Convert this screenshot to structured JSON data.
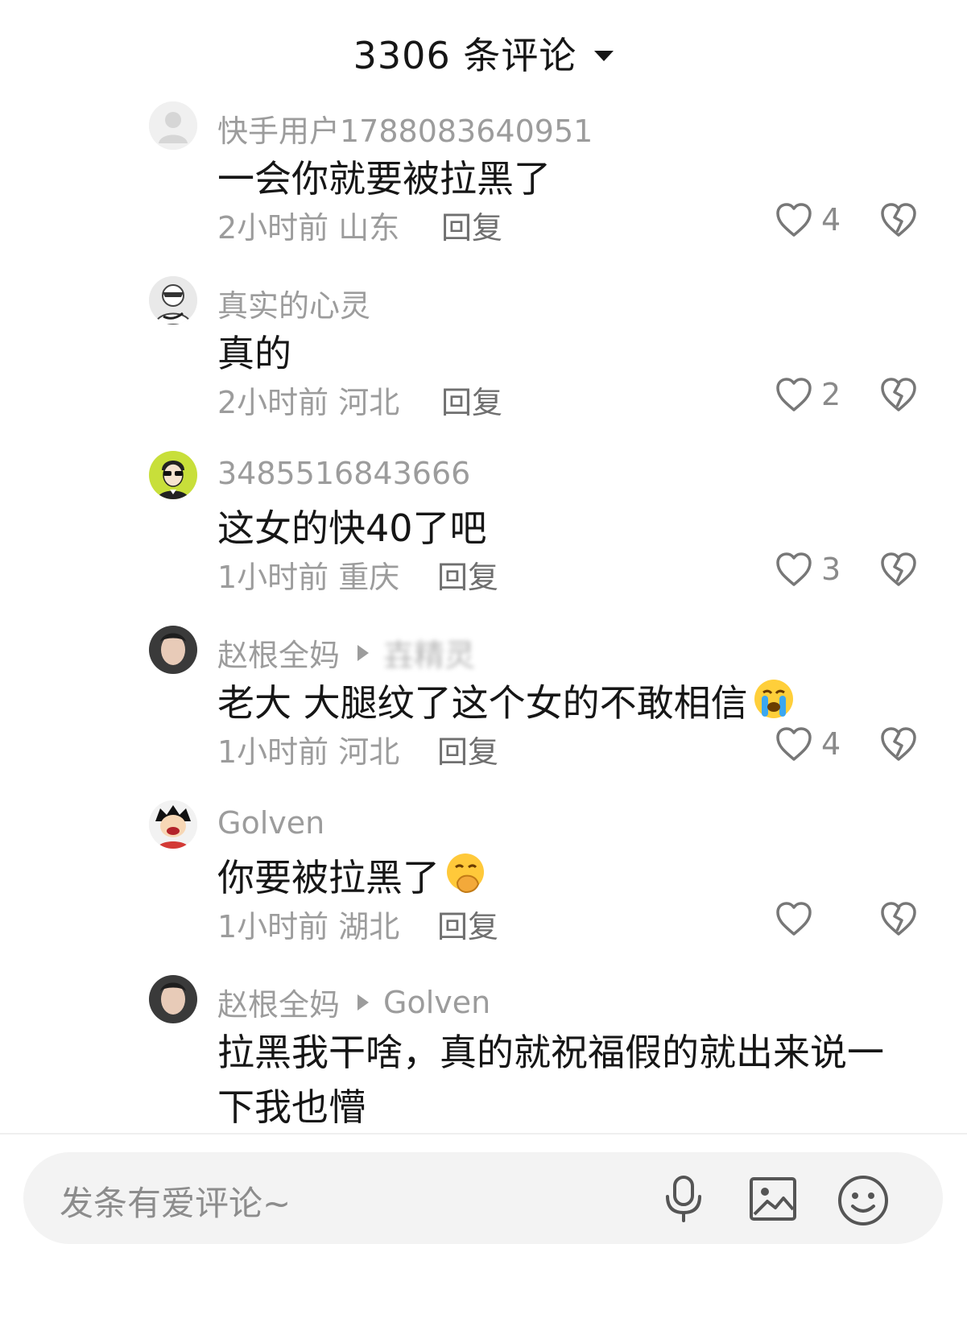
{
  "header": {
    "title": "3306 条评论"
  },
  "comments": [
    {
      "user": "快手用户1788083640951",
      "reply_to": "",
      "text": "一会你就要被拉黑了",
      "time": "2小时前",
      "location": "山东",
      "reply_label": "回复",
      "likes": "4",
      "avatar": "default-avatar"
    },
    {
      "user": "真实的心灵",
      "reply_to": "",
      "text": "真的",
      "time": "2小时前",
      "location": "河北",
      "reply_label": "回复",
      "likes": "2",
      "avatar": "cartoon-avatar"
    },
    {
      "user": "3485516843666",
      "reply_to": "",
      "text": "这女的快40了吧",
      "time": "1小时前",
      "location": "重庆",
      "reply_label": "回复",
      "likes": "3",
      "avatar": "sunglasses-avatar"
    },
    {
      "user": "赵根全妈",
      "reply_to": "壵精灵",
      "text": "老大 大腿纹了这个女的不敢相信",
      "emoji": "crying-face-emoji",
      "time": "1小时前",
      "location": "河北",
      "reply_label": "回复",
      "likes": "4",
      "avatar": "photo-avatar"
    },
    {
      "user": "Golven",
      "reply_to": "",
      "text": "你要被拉黑了",
      "emoji": "hand-over-mouth-emoji",
      "time": "1小时前",
      "location": "湖北",
      "reply_label": "回复",
      "likes": "",
      "avatar": "anime-avatar"
    },
    {
      "user": "赵根全妈",
      "reply_to": "Golven",
      "text": "拉黑我干啥，真的就祝福假的就出来说一下我也懵",
      "avatar": "photo-avatar"
    }
  ],
  "input": {
    "placeholder": "发条有爱评论~",
    "icons": [
      "microphone-icon",
      "image-icon",
      "emoji-icon"
    ]
  },
  "colors": {
    "text": "#161616",
    "muted": "#9c9c9c",
    "input_bg": "#f3f3f3"
  }
}
